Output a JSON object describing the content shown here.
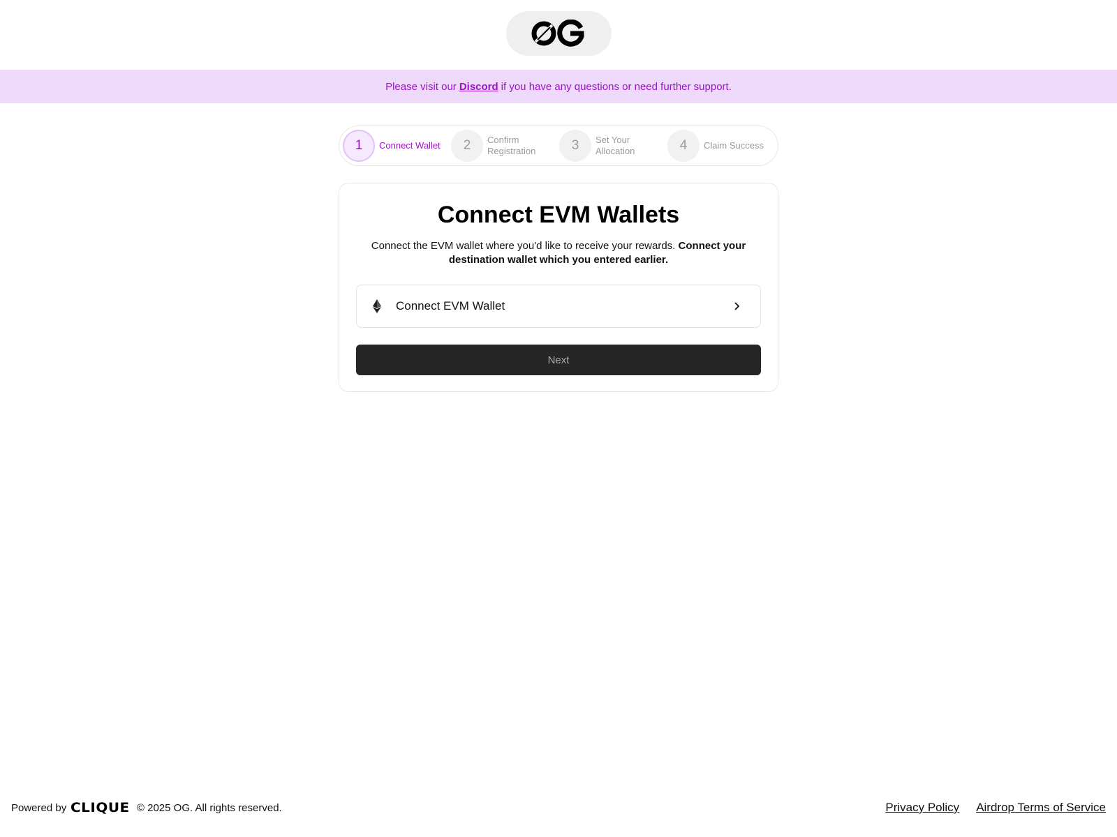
{
  "header": {
    "logo_text": "OG"
  },
  "banner": {
    "prefix": "Please visit our",
    "link": "Discord",
    "suffix": "if you have any questions or need further support."
  },
  "steps": [
    {
      "number": "1",
      "label": "Connect Wallet",
      "active": true
    },
    {
      "number": "2",
      "label": "Confirm Registration",
      "active": false
    },
    {
      "number": "3",
      "label": "Set Your Allocation",
      "active": false
    },
    {
      "number": "4",
      "label": "Claim Success",
      "active": false
    }
  ],
  "card": {
    "title": "Connect EVM Wallets",
    "description": "Connect the EVM wallet where you'd like to receive your rewards.",
    "description_bold": "Connect your destination wallet which you entered earlier.",
    "wallet_button": {
      "label": "Connect EVM Wallet",
      "icon": "ethereum-icon"
    },
    "next_label": "Next"
  },
  "footer": {
    "powered_by": "Powered by",
    "brand": "CLIQUE",
    "copyright": "© 2025 OG. All rights reserved.",
    "links": [
      "Privacy Policy",
      "Airdrop Terms of Service"
    ]
  },
  "colors": {
    "accent": "#9c14c9",
    "banner_bg": "#eed9fa",
    "next_bg": "#262626"
  }
}
